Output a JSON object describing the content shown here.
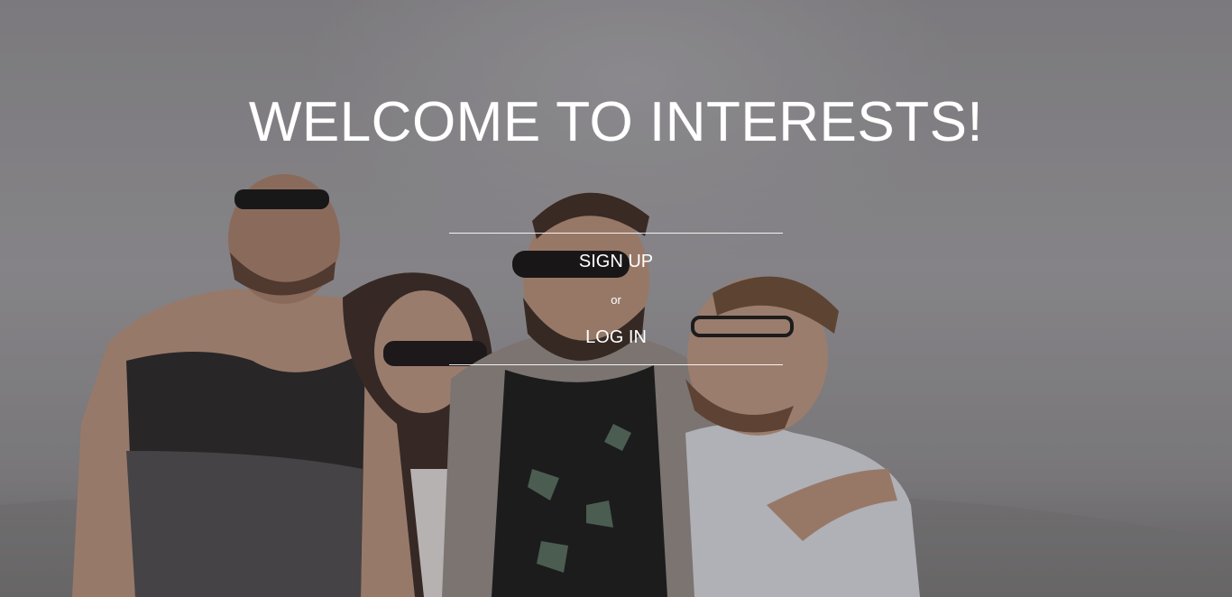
{
  "hero": {
    "title": "WELCOME TO INTERESTS!",
    "image_subject": "group-of-friends-laughing-photo"
  },
  "auth": {
    "signup_label": "SIGN UP",
    "separator": "or",
    "login_label": "LOG IN"
  },
  "colors": {
    "text": "#ffffff",
    "overlay": "#8f8d8f"
  }
}
